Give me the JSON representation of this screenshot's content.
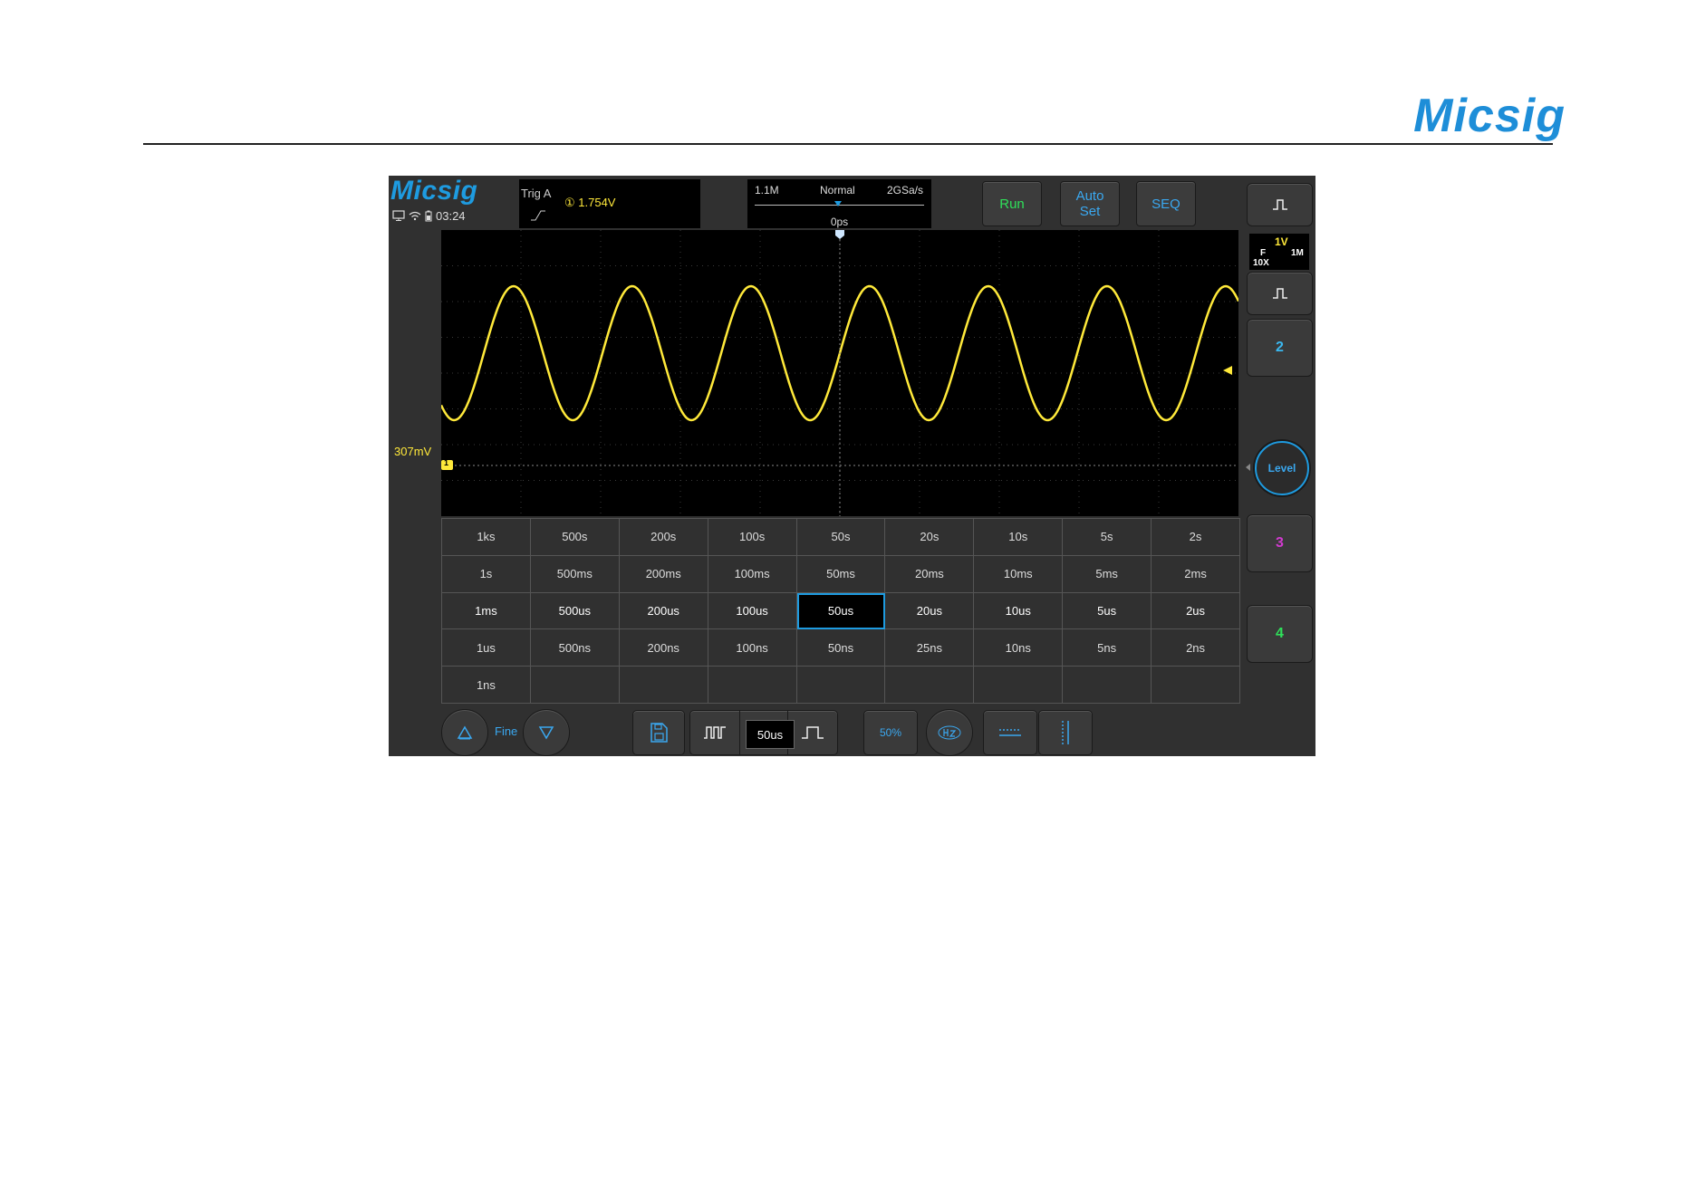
{
  "page": {
    "brand": "Micsig"
  },
  "scope": {
    "logo": "Micsig",
    "status": {
      "time": "03:24",
      "icons": [
        "monitor-icon",
        "wifi-icon",
        "battery-icon"
      ]
    },
    "trigger": {
      "label": "Trig  A",
      "channel_value": "① 1.754V",
      "edge_icon": "rising-edge-icon"
    },
    "acquisition": {
      "memory": "1.1M",
      "mode": "Normal",
      "sample_rate": "2GSa/s",
      "position": "0ps"
    },
    "buttons": {
      "run": "Run",
      "auto_set_line1": "Auto",
      "auto_set_line2": "Set",
      "seq": "SEQ"
    },
    "channel1": {
      "offset_label": "307mV",
      "marker": "1",
      "volts": "1V",
      "coupling": "F",
      "impedance": "1M",
      "probe": "10X"
    },
    "side": {
      "ch2": "2",
      "level": "Level",
      "ch3": "3",
      "ch4": "4"
    },
    "colors": {
      "ch1": "#ffe93a",
      "ch2": "#3ab8f0",
      "ch3": "#d23ad0",
      "ch4": "#2fe05a",
      "accent": "#1e9be0"
    },
    "timebase": {
      "rows": [
        [
          "1ks",
          "500s",
          "200s",
          "100s",
          "50s",
          "20s",
          "10s",
          "5s",
          "2s"
        ],
        [
          "1s",
          "500ms",
          "200ms",
          "100ms",
          "50ms",
          "20ms",
          "10ms",
          "5ms",
          "2ms"
        ],
        [
          "1ms",
          "500us",
          "200us",
          "100us",
          "50us",
          "20us",
          "10us",
          "5us",
          "2us"
        ],
        [
          "1us",
          "500ns",
          "200ns",
          "100ns",
          "50ns",
          "25ns",
          "10ns",
          "5ns",
          "2ns"
        ],
        [
          "1ns",
          "",
          "",
          "",
          "",
          "",
          "",
          "",
          ""
        ]
      ],
      "selected": "50us"
    },
    "bottom": {
      "fine": "Fine",
      "timebase_value": "50us",
      "fifty_percent": "50%"
    }
  }
}
